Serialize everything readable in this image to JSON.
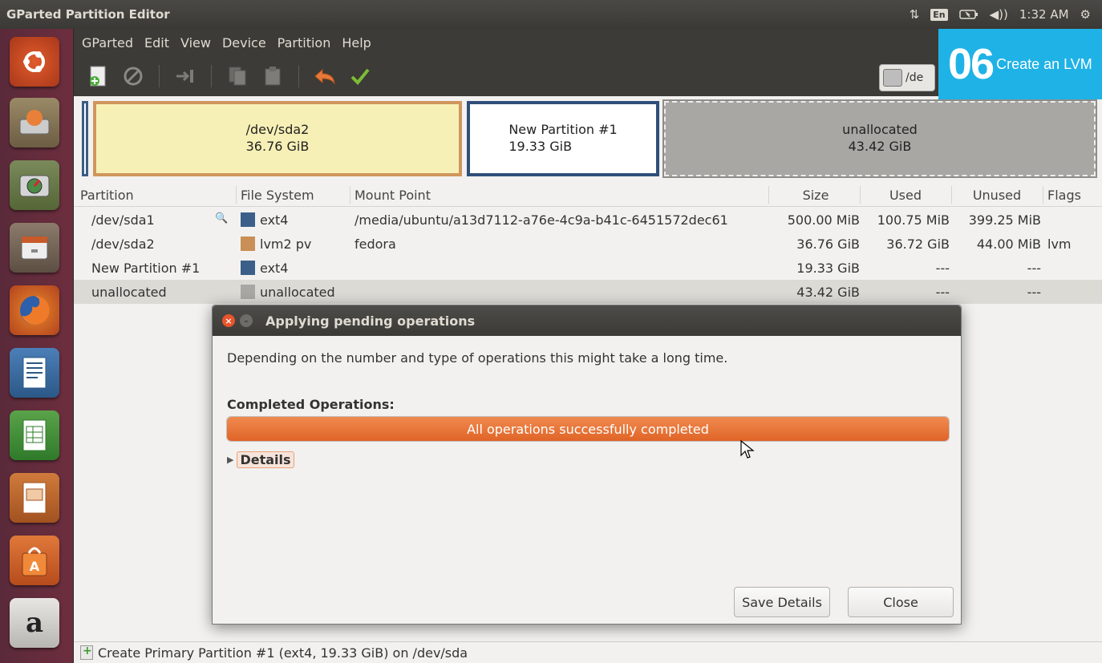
{
  "app_title": "GParted Partition Editor",
  "tray": {
    "network_icon": "network-updown-icon",
    "keyboard_label": "En",
    "battery_icon": "battery-icon",
    "volume_icon": "volume-icon",
    "clock": "1:32 AM",
    "settings_icon": "gear-icon"
  },
  "menu": [
    "GParted",
    "Edit",
    "View",
    "Device",
    "Partition",
    "Help"
  ],
  "toolbar": {
    "device_label": "/de"
  },
  "step_badge": {
    "number": "06",
    "text": "Create an LVM"
  },
  "partition_map": {
    "sda2_name": "/dev/sda2",
    "sda2_size": "36.76 GiB",
    "new_name": "New Partition #1",
    "new_size": "19.33 GiB",
    "unalloc_name": "unallocated",
    "unalloc_size": "43.42 GiB"
  },
  "table": {
    "headers": {
      "partition": "Partition",
      "fs": "File System",
      "mount": "Mount Point",
      "size": "Size",
      "used": "Used",
      "unused": "Unused",
      "flags": "Flags"
    },
    "rows": [
      {
        "partition": "/dev/sda1",
        "fs": "ext4",
        "fs_color": "#3b5f88",
        "mount": "/media/ubuntu/a13d7112-a76e-4c9a-b41c-6451572dec61",
        "size": "500.00 MiB",
        "used": "100.75 MiB",
        "unused": "399.25 MiB",
        "flags": ""
      },
      {
        "partition": "/dev/sda2",
        "fs": "lvm2 pv",
        "fs_color": "#c98f56",
        "mount": "fedora",
        "size": "36.76 GiB",
        "used": "36.72 GiB",
        "unused": "44.00 MiB",
        "flags": "lvm"
      },
      {
        "partition": "New Partition #1",
        "fs": "ext4",
        "fs_color": "#3b5f88",
        "mount": "",
        "size": "19.33 GiB",
        "used": "---",
        "unused": "---",
        "flags": ""
      },
      {
        "partition": "unallocated",
        "fs": "unallocated",
        "fs_color": "#a8a7a3",
        "mount": "",
        "size": "43.42 GiB",
        "used": "---",
        "unused": "---",
        "flags": ""
      }
    ]
  },
  "dialog": {
    "title": "Applying pending operations",
    "description": "Depending on the number and type of operations this might take a long time.",
    "completed_label": "Completed Operations:",
    "progress_text": "All operations successfully completed",
    "progress_fraction": 1.0,
    "details_label": "Details",
    "save_details_label": "Save Details",
    "close_label": "Close"
  },
  "status_bar": {
    "text": "Create Primary Partition #1 (ext4, 19.33 GiB) on /dev/sda"
  },
  "colors": {
    "accent_orange": "#e06427",
    "badge_blue": "#1fb2e6",
    "launcher": "#6d2e3e"
  }
}
